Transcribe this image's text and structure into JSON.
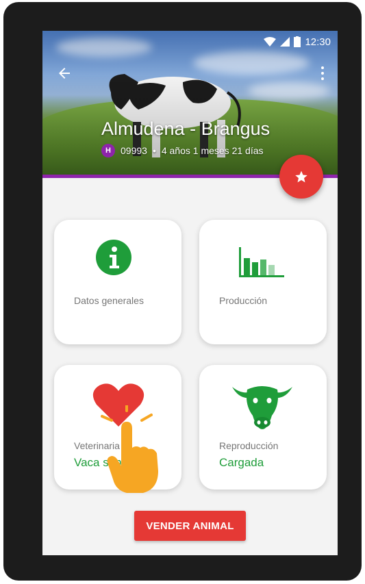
{
  "status_bar": {
    "time": "12:30"
  },
  "animal": {
    "name": "Almudena - Brangus",
    "badge": "H",
    "id": "09993",
    "separator": "•",
    "age": "4 años 1 meses 21 días"
  },
  "cards": [
    {
      "label": "Datos generales",
      "status": "",
      "icon": "info-icon"
    },
    {
      "label": "Producción",
      "status": "",
      "icon": "bar-chart-icon"
    },
    {
      "label": "Veterinaria",
      "status": "Vaca sana",
      "icon": "heart-icon"
    },
    {
      "label": "Reproducción",
      "status": "Cargada",
      "icon": "cow-head-icon"
    }
  ],
  "actions": {
    "sell_label": "VENDER ANIMAL"
  },
  "colors": {
    "accent_red": "#e53935",
    "accent_purple": "#8e24aa",
    "status_green": "#1f9d3a"
  }
}
